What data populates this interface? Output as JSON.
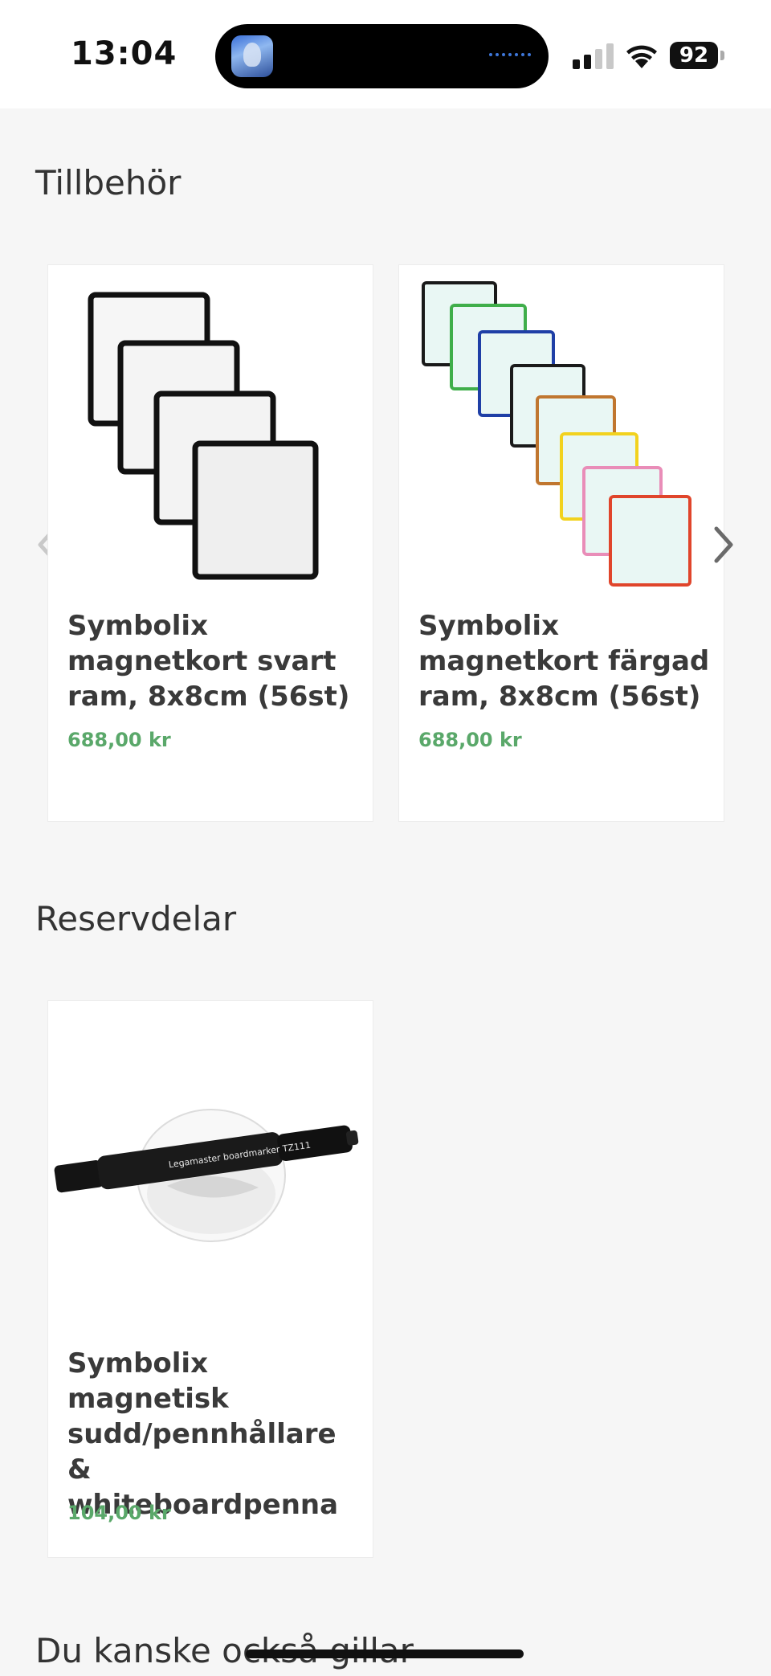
{
  "status_bar": {
    "time": "13:04",
    "battery": "92",
    "icons": [
      "signal-icon",
      "wifi-icon",
      "battery-icon"
    ]
  },
  "sections": {
    "accessories": {
      "title": "Tillbehör",
      "products": [
        {
          "title": "Symbolix magnetkort svart ram, 8x8cm (56st)",
          "price": "688,00 kr",
          "icon": "black-frame-magnet-cards-image"
        },
        {
          "title": "Symbolix magnetkort färgad ram, 8x8cm (56st)",
          "price": "688,00 kr",
          "icon": "colored-frame-magnet-cards-image"
        }
      ],
      "carousel": {
        "prev_icon": "chevron-left-icon",
        "next_icon": "chevron-right-icon"
      }
    },
    "spare_parts": {
      "title": "Reservdelar",
      "products": [
        {
          "title": "Symbolix magnetisk sudd/pennhållare & whiteboardpenna",
          "price": "104,00 kr",
          "icon": "eraser-marker-image",
          "marker_print": "Legamaster boardmarker TZ111"
        }
      ]
    },
    "you_may_like": {
      "title": "Du kanske också gillar"
    }
  },
  "colors": {
    "price": "#5aa86a",
    "background": "#f6f6f6",
    "card": "#ffffff",
    "frames": [
      "#111111",
      "#2a2a2a",
      "#3fae4a",
      "#1f3fa6",
      "#c0762f",
      "#f2d21e",
      "#e98db8",
      "#e0452b"
    ]
  }
}
